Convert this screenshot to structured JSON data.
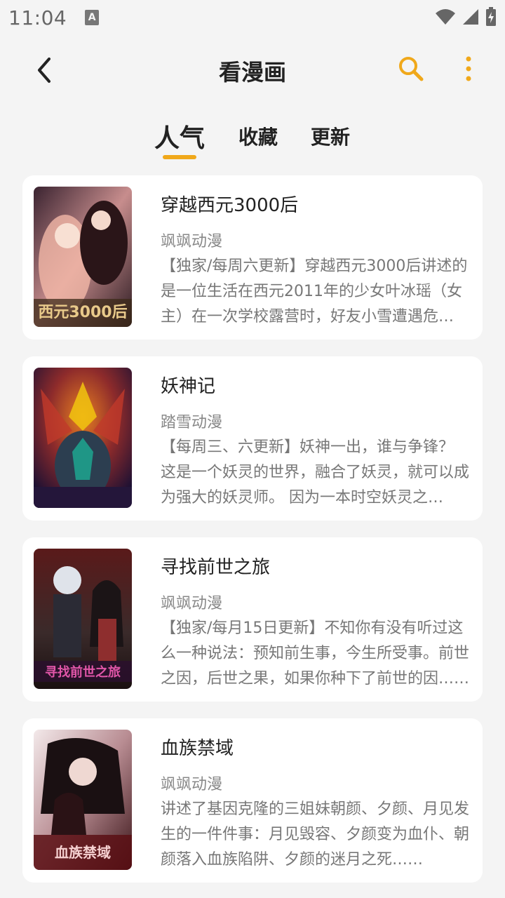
{
  "status_bar": {
    "time": "11:04",
    "notification_icon": "accessibility-a-icon",
    "icons": [
      "wifi-icon",
      "cell-signal-icon",
      "battery-charging-icon"
    ]
  },
  "header": {
    "title": "看漫画",
    "back_icon": "chevron-left-icon",
    "search_icon": "search-icon",
    "more_icon": "more-vertical-icon",
    "accent_color": "#f0a81a"
  },
  "tabs": [
    {
      "label": "人气",
      "active": true
    },
    {
      "label": "收藏",
      "active": false
    },
    {
      "label": "更新",
      "active": false
    }
  ],
  "comics": [
    {
      "title": "穿越西元3000后",
      "author": "飒飒动漫",
      "description": "【独家/每周六更新】穿越西元3000后讲述的是一位生活在西元2011年的少女叶冰瑶（女主）在一次学校露营时，好友小雪遭遇危险……",
      "cover_text": "西元3000后"
    },
    {
      "title": "妖神记",
      "author": "踏雪动漫",
      "description": "【每周三、六更新】妖神一出，谁与争锋？ 这是一个妖灵的世界，融合了妖灵，就可以成为强大的妖灵师。 因为一本时空妖灵之书……",
      "cover_text": ""
    },
    {
      "title": "寻找前世之旅",
      "author": "飒飒动漫",
      "description": "【独家/每月15日更新】不知你有没有听过这么一种说法：预知前生事，今生所受事。前世之因，后世之果，如果你种下了前世的因……",
      "cover_text": "寻找前世之旅"
    },
    {
      "title": "血族禁域",
      "author": "飒飒动漫",
      "description": "讲述了基因克隆的三姐妹朝颜、夕颜、月见发生的一件件事：月见毁容、夕颜变为血仆、朝颜落入血族陷阱、夕颜的迷月之死……",
      "cover_text": "血族禁域"
    }
  ]
}
